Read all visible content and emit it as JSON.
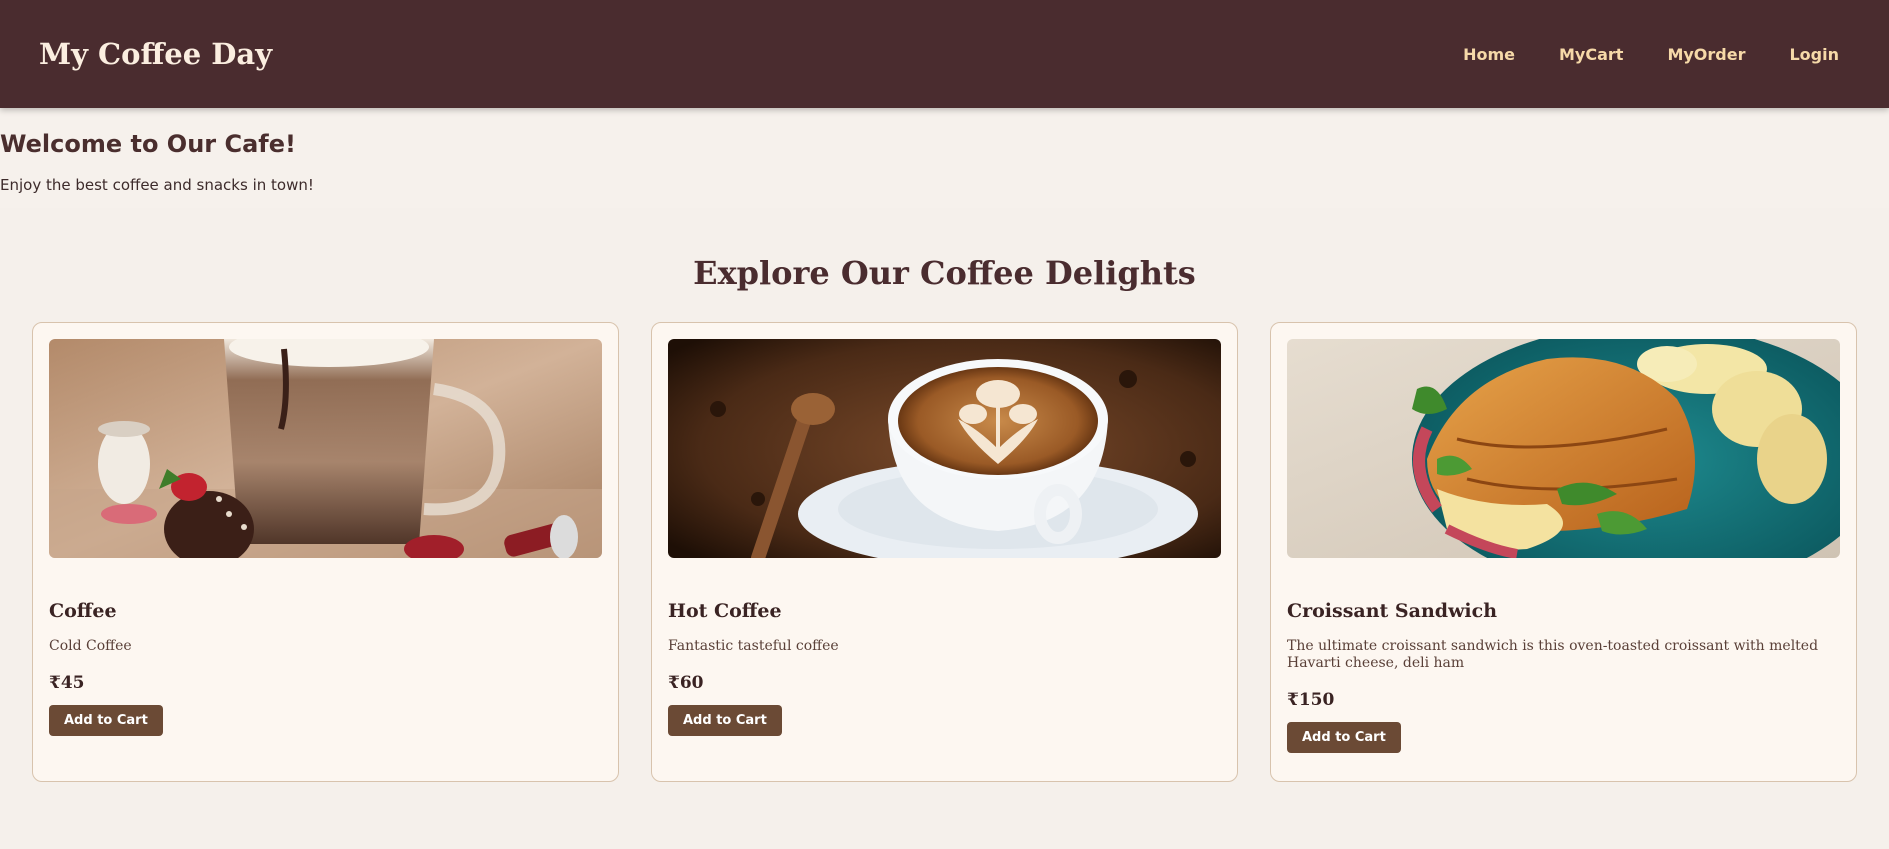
{
  "navbar": {
    "brand": "My Coffee Day",
    "links": [
      "Home",
      "MyCart",
      "MyOrder",
      "Login"
    ]
  },
  "welcome": {
    "title": "Welcome to Our Cafe!",
    "subtitle": "Enjoy the best coffee and snacks in town!"
  },
  "explore": {
    "title": "Explore Our Coffee Delights"
  },
  "products": [
    {
      "name": "Coffee",
      "description": "Cold Coffee",
      "price": "₹45",
      "button": "Add to Cart",
      "image": "iced-mocha-photo"
    },
    {
      "name": "Hot Coffee",
      "description": "Fantastic tasteful coffee",
      "price": "₹60",
      "button": "Add to Cart",
      "image": "latte-art-photo"
    },
    {
      "name": "Croissant Sandwich",
      "description": "The ultimate croissant sandwich is this oven-toasted croissant with melted Havarti cheese, deli ham",
      "price": "₹150",
      "button": "Add to Cart",
      "image": "croissant-sandwich-photo"
    }
  ],
  "colors": {
    "navbar_bg": "#4a2c2f",
    "nav_link": "#f6d9a8",
    "page_bg": "#f5f0eb",
    "card_bg": "#fdf7f1",
    "button_bg": "#6b4a35"
  }
}
